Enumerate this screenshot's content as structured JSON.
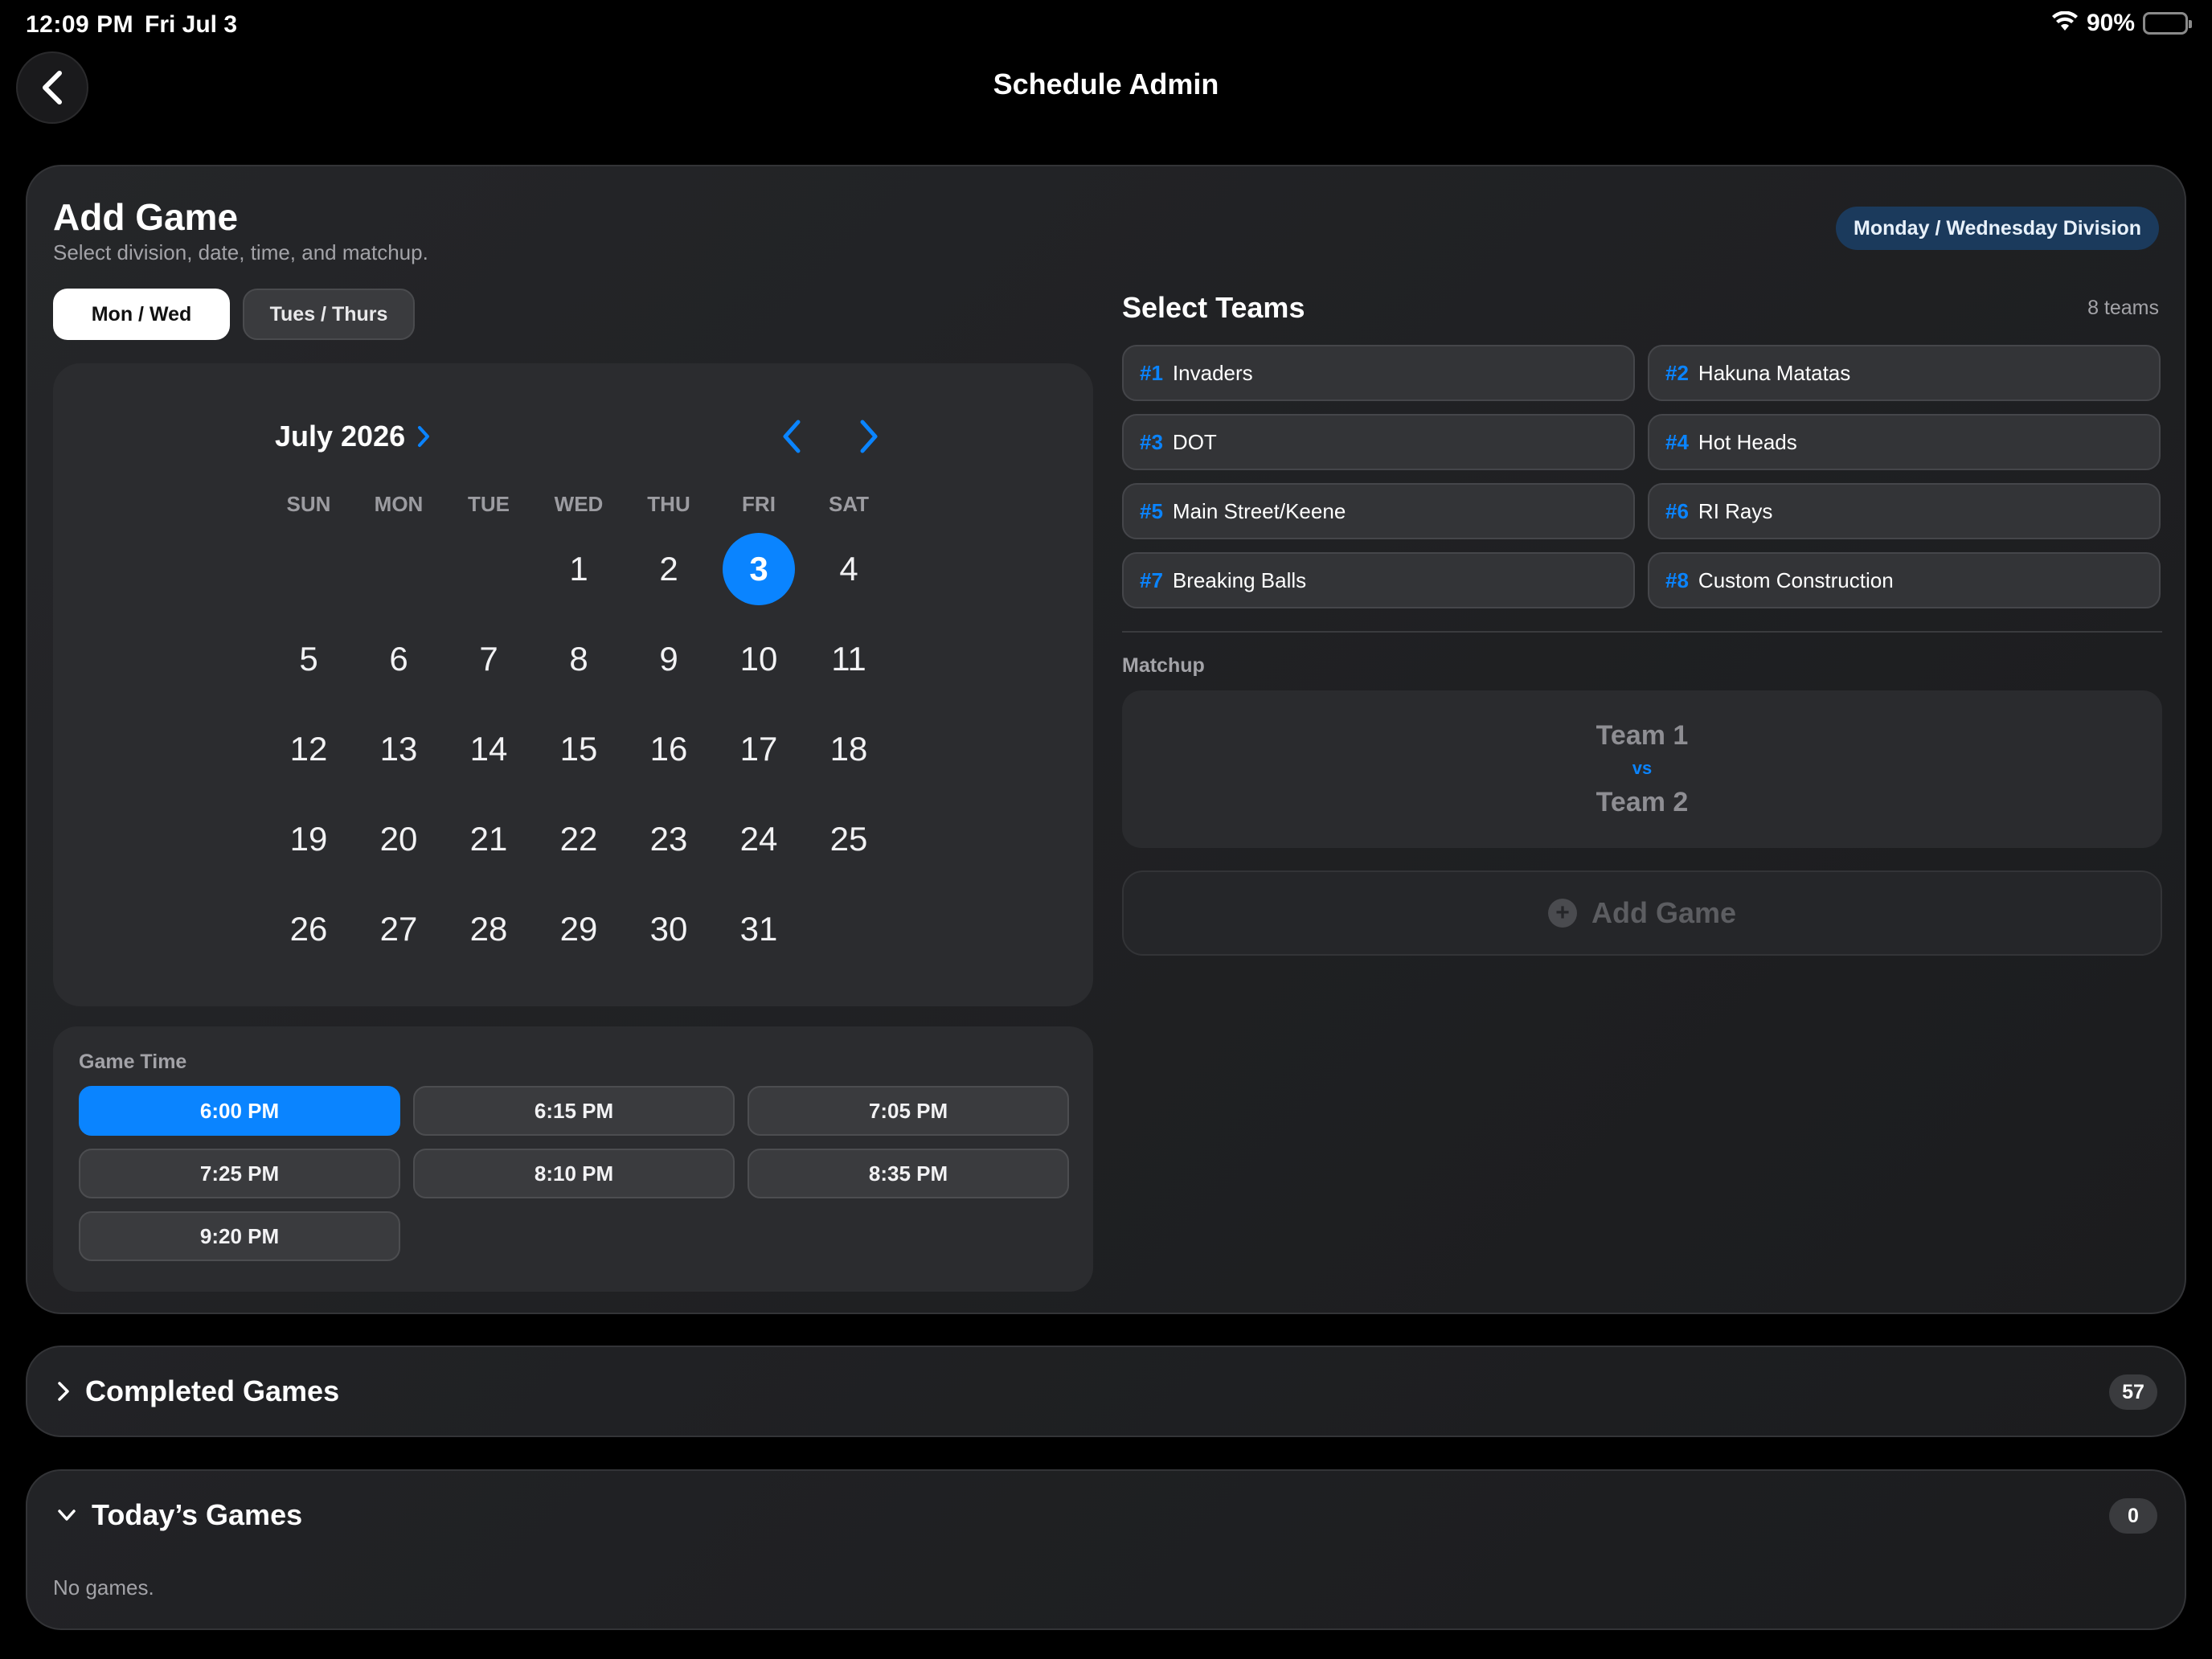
{
  "status_bar": {
    "time": "12:09 PM",
    "date": "Fri Jul 3",
    "battery": "90%"
  },
  "nav": {
    "title": "Schedule Admin"
  },
  "add_game": {
    "title": "Add Game",
    "subtitle": "Select division, date, time, and matchup.",
    "division_badge": "Monday / Wednesday Division",
    "segments": {
      "selected": "Mon / Wed",
      "other": "Tues / Thurs"
    }
  },
  "calendar": {
    "month_label": "July 2026",
    "weekdays": [
      "SUN",
      "MON",
      "TUE",
      "WED",
      "THU",
      "FRI",
      "SAT"
    ],
    "days": [
      "",
      "",
      "",
      "1",
      "2",
      "3",
      "4",
      "5",
      "6",
      "7",
      "8",
      "9",
      "10",
      "11",
      "12",
      "13",
      "14",
      "15",
      "16",
      "17",
      "18",
      "19",
      "20",
      "21",
      "22",
      "23",
      "24",
      "25",
      "26",
      "27",
      "28",
      "29",
      "30",
      "31",
      ""
    ],
    "selected_day": "3"
  },
  "game_time": {
    "label": "Game Time",
    "times": [
      "6:00 PM",
      "6:15 PM",
      "7:05 PM",
      "7:25 PM",
      "8:10 PM",
      "8:35 PM",
      "9:20 PM"
    ],
    "selected": "6:00 PM"
  },
  "teams": {
    "title": "Select Teams",
    "count": "8 teams",
    "list": [
      {
        "num": "#1",
        "name": "Invaders"
      },
      {
        "num": "#2",
        "name": "Hakuna Matatas"
      },
      {
        "num": "#3",
        "name": "DOT"
      },
      {
        "num": "#4",
        "name": "Hot Heads"
      },
      {
        "num": "#5",
        "name": "Main Street/Keene"
      },
      {
        "num": "#6",
        "name": "RI Rays"
      },
      {
        "num": "#7",
        "name": "Breaking Balls"
      },
      {
        "num": "#8",
        "name": "Custom Construction"
      }
    ]
  },
  "matchup": {
    "label": "Matchup",
    "team1": "Team 1",
    "vs": "vs",
    "team2": "Team 2"
  },
  "add_button": {
    "label": "Add Game"
  },
  "completed": {
    "title": "Completed Games",
    "count": "57"
  },
  "today": {
    "title": "Today’s Games",
    "count": "0",
    "empty": "No games."
  },
  "colors": {
    "accent": "#0a84ff",
    "battery": "#34c759",
    "badge_bg": "#1b3a5c"
  }
}
